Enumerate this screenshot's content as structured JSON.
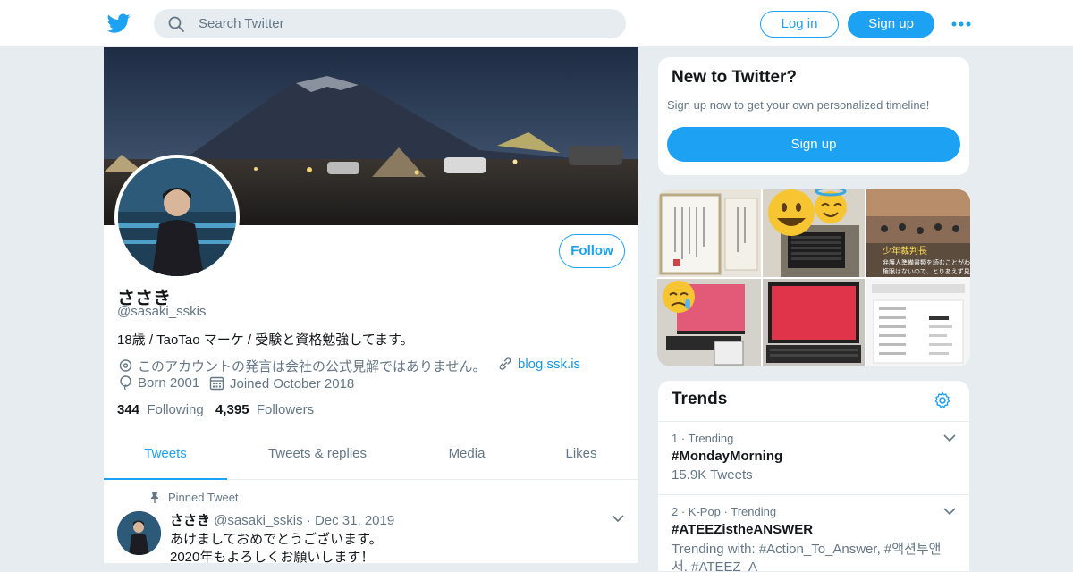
{
  "header": {
    "search_placeholder": "Search Twitter",
    "login_label": "Log in",
    "signup_label": "Sign up"
  },
  "profile": {
    "follow_label": "Follow",
    "name": "ささき",
    "handle": "@sasaki_sskis",
    "bio": "18歳 / TaoTao マーケ / 受験と資格勉強してます。",
    "location": "このアカウントの発言は会社の公式見解ではありません。",
    "website": "blog.ssk.is",
    "born": "Born 2001",
    "joined": "Joined October 2018",
    "following_count": "344",
    "following_label": "Following",
    "followers_count": "4,395",
    "followers_label": "Followers"
  },
  "tabs": [
    {
      "label": "Tweets"
    },
    {
      "label": "Tweets & replies"
    },
    {
      "label": "Media"
    },
    {
      "label": "Likes"
    }
  ],
  "pinned_tweet": {
    "pinned_label": "Pinned Tweet",
    "author": "ささき",
    "handle": "@sasaki_sskis",
    "separator": "·",
    "date": "Dec 31, 2019",
    "line1": "あけましておめでとうございます。",
    "line2": "2020年もよろしくお願いします！"
  },
  "new_to_twitter": {
    "title": "New to Twitter?",
    "subtitle": "Sign up now to get your own personalized timeline!",
    "button_label": "Sign up"
  },
  "media_grid": {
    "overlay_text_title": "少年裁判長",
    "overlay_text_body": "弁護人準備書類を読むことがわかる\n権限はないので、とりあえず見発"
  },
  "trends": {
    "title": "Trends",
    "items": [
      {
        "context": "1 · Trending",
        "name": "#MondayMorning",
        "count": "15.9K Tweets"
      },
      {
        "context": "2 · K-Pop · Trending",
        "name": "#ATEEZistheANSWER",
        "count": "Trending with: #Action_To_Answer, #액션투앤서, #ATEEZ_A"
      }
    ]
  },
  "colors": {
    "accent": "#1da1f2",
    "background": "#e6ecf0",
    "secondary_text": "#657786"
  }
}
